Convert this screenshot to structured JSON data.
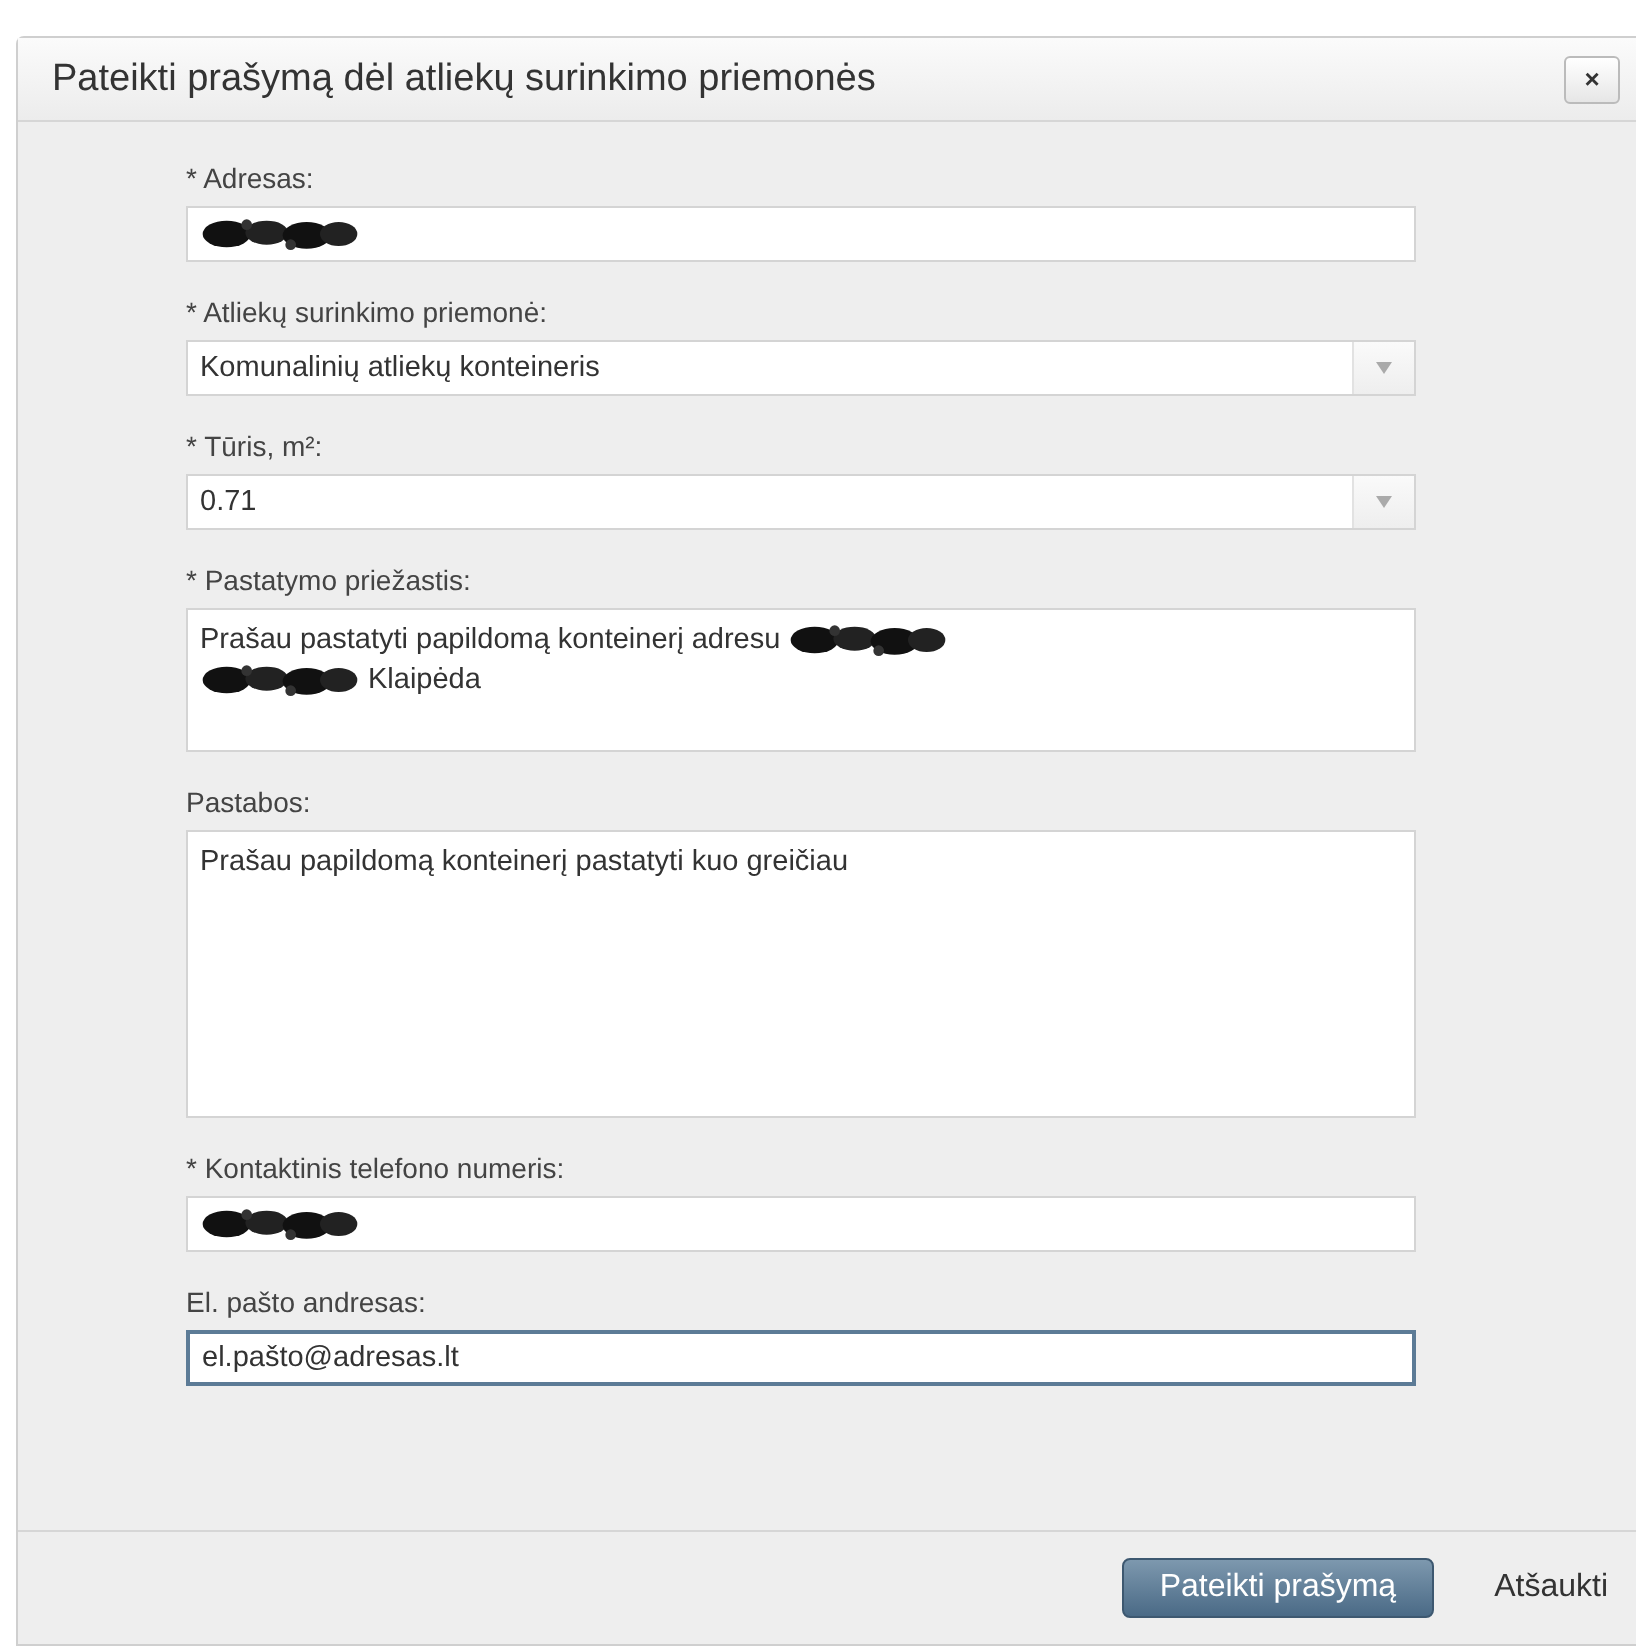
{
  "dialog": {
    "title": "Pateikti prašymą dėl atliekų surinkimo priemonės",
    "close_button": "×"
  },
  "fields": [
    {
      "kind": "text",
      "label": "* Adresas:",
      "focused": false,
      "lines": [
        [
          {
            "kind": "redacted"
          }
        ]
      ]
    },
    {
      "kind": "select",
      "label": "* Atliekų surinkimo priemonė:",
      "focused": false,
      "lines": [
        [
          {
            "kind": "text",
            "text": "Komunalinių atliekų konteineris"
          }
        ]
      ]
    },
    {
      "kind": "select",
      "label": "* Tūris, m²:",
      "focused": false,
      "lines": [
        [
          {
            "kind": "text",
            "text": "0.71"
          }
        ]
      ]
    },
    {
      "kind": "textarea",
      "label": "* Pastatymo priežastis:",
      "focused": false,
      "lines": [
        [
          {
            "kind": "text",
            "text": "Prašau pastatyti papildomą konteinerį adresu"
          },
          {
            "kind": "redacted"
          }
        ],
        [
          {
            "kind": "redacted"
          },
          {
            "kind": "text",
            "text": "Klaipėda"
          }
        ]
      ]
    },
    {
      "kind": "tall_textarea",
      "label": "Pastabos:",
      "focused": false,
      "lines": [
        [
          {
            "kind": "text",
            "text": "Prašau papildomą konteinerį pastatyti kuo greičiau"
          }
        ]
      ]
    },
    {
      "kind": "text",
      "label": "* Kontaktinis telefono numeris:",
      "focused": false,
      "lines": [
        [
          {
            "kind": "redacted"
          }
        ]
      ]
    },
    {
      "kind": "text",
      "label": "El. pašto andresas:",
      "focused": true,
      "lines": [
        [
          {
            "kind": "text",
            "text": "el.pašto@adresas.lt"
          }
        ]
      ]
    }
  ],
  "buttons": [
    {
      "kind": "primary",
      "label": "Pateikti prašymą"
    },
    {
      "kind": "link",
      "label": "Atšaukti"
    }
  ]
}
